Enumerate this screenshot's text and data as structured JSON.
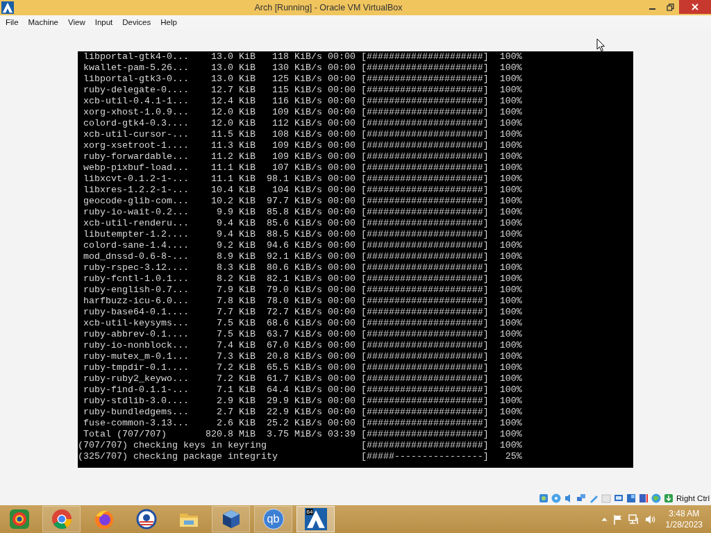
{
  "window": {
    "title": "Arch [Running] - Oracle VM VirtualBox"
  },
  "menu": [
    "File",
    "Machine",
    "View",
    "Input",
    "Devices",
    "Help"
  ],
  "terminal": {
    "lines": [
      " libportal-gtk4-0...    13.0 KiB   118 KiB/s 00:00 [#####################]  100%",
      " kwallet-pam-5.26...    13.0 KiB   130 KiB/s 00:00 [#####################]  100%",
      " libportal-gtk3-0...    13.0 KiB   125 KiB/s 00:00 [#####################]  100%",
      " ruby-delegate-0....    12.7 KiB   115 KiB/s 00:00 [#####################]  100%",
      " xcb-util-0.4.1-1...    12.4 KiB   116 KiB/s 00:00 [#####################]  100%",
      " xorg-xhost-1.0.9...    12.0 KiB   109 KiB/s 00:00 [#####################]  100%",
      " colord-gtk4-0.3....    12.0 KiB   112 KiB/s 00:00 [#####################]  100%",
      " xcb-util-cursor-...    11.5 KiB   108 KiB/s 00:00 [#####################]  100%",
      " xorg-xsetroot-1....    11.3 KiB   109 KiB/s 00:00 [#####################]  100%",
      " ruby-forwardable...    11.2 KiB   109 KiB/s 00:00 [#####################]  100%",
      " webp-pixbuf-load...    11.1 KiB   107 KiB/s 00:00 [#####################]  100%",
      " libxcvt-0.1.2-1-...    11.1 KiB  98.1 KiB/s 00:00 [#####################]  100%",
      " libxres-1.2.2-1-...    10.4 KiB   104 KiB/s 00:00 [#####################]  100%",
      " geocode-glib-com...    10.2 KiB  97.7 KiB/s 00:00 [#####################]  100%",
      " ruby-io-wait-0.2...     9.9 KiB  85.8 KiB/s 00:00 [#####################]  100%",
      " xcb-util-renderu...     9.4 KiB  85.6 KiB/s 00:00 [#####################]  100%",
      " libutempter-1.2....     9.4 KiB  88.5 KiB/s 00:00 [#####################]  100%",
      " colord-sane-1.4....     9.2 KiB  94.6 KiB/s 00:00 [#####################]  100%",
      " mod_dnssd-0.6-8-...     8.9 KiB  92.1 KiB/s 00:00 [#####################]  100%",
      " ruby-rspec-3.12....     8.3 KiB  80.6 KiB/s 00:00 [#####################]  100%",
      " ruby-fcntl-1.0.1...     8.2 KiB  82.1 KiB/s 00:00 [#####################]  100%",
      " ruby-english-0.7...     7.9 KiB  79.0 KiB/s 00:00 [#####################]  100%",
      " harfbuzz-icu-6.0...     7.8 KiB  78.0 KiB/s 00:00 [#####################]  100%",
      " ruby-base64-0.1....     7.7 KiB  72.7 KiB/s 00:00 [#####################]  100%",
      " xcb-util-keysyms...     7.5 KiB  68.6 KiB/s 00:00 [#####################]  100%",
      " ruby-abbrev-0.1....     7.5 KiB  63.7 KiB/s 00:00 [#####################]  100%",
      " ruby-io-nonblock...     7.4 KiB  67.0 KiB/s 00:00 [#####################]  100%",
      " ruby-mutex_m-0.1...     7.3 KiB  20.8 KiB/s 00:00 [#####################]  100%",
      " ruby-tmpdir-0.1....     7.2 KiB  65.5 KiB/s 00:00 [#####################]  100%",
      " ruby-ruby2_keywo...     7.2 KiB  61.7 KiB/s 00:00 [#####################]  100%",
      " ruby-find-0.1.1-...     7.1 KiB  64.4 KiB/s 00:00 [#####################]  100%",
      " ruby-stdlib-3.0....     2.9 KiB  29.9 KiB/s 00:00 [#####################]  100%",
      " ruby-bundledgems...     2.7 KiB  22.9 KiB/s 00:00 [#####################]  100%",
      " fuse-common-3.13...     2.6 KiB  25.2 KiB/s 00:00 [#####################]  100%",
      " Total (707/707)       820.8 MiB  3.75 MiB/s 03:39 [#####################]  100%",
      "(707/707) checking keys in keyring                 [#####################]  100%",
      "(325/707) checking package integrity               [#####----------------]   25%"
    ]
  },
  "status_bar": {
    "host_key": "Right Ctrl"
  },
  "taskbar": {
    "apps": [
      {
        "kind": "ring",
        "running": false,
        "selected": false
      },
      {
        "kind": "chrome",
        "running": true,
        "selected": false
      },
      {
        "kind": "firefox",
        "running": false,
        "selected": false
      },
      {
        "kind": "rising-sun",
        "running": false,
        "selected": false
      },
      {
        "kind": "folder",
        "running": false,
        "selected": false
      },
      {
        "kind": "cube",
        "running": true,
        "selected": false
      },
      {
        "kind": "qb",
        "label": "qb",
        "running": true,
        "selected": false
      },
      {
        "kind": "arch",
        "label": "64",
        "running": true,
        "selected": true
      }
    ],
    "clock": {
      "time": "3:48 AM",
      "date": "1/28/2023"
    }
  }
}
